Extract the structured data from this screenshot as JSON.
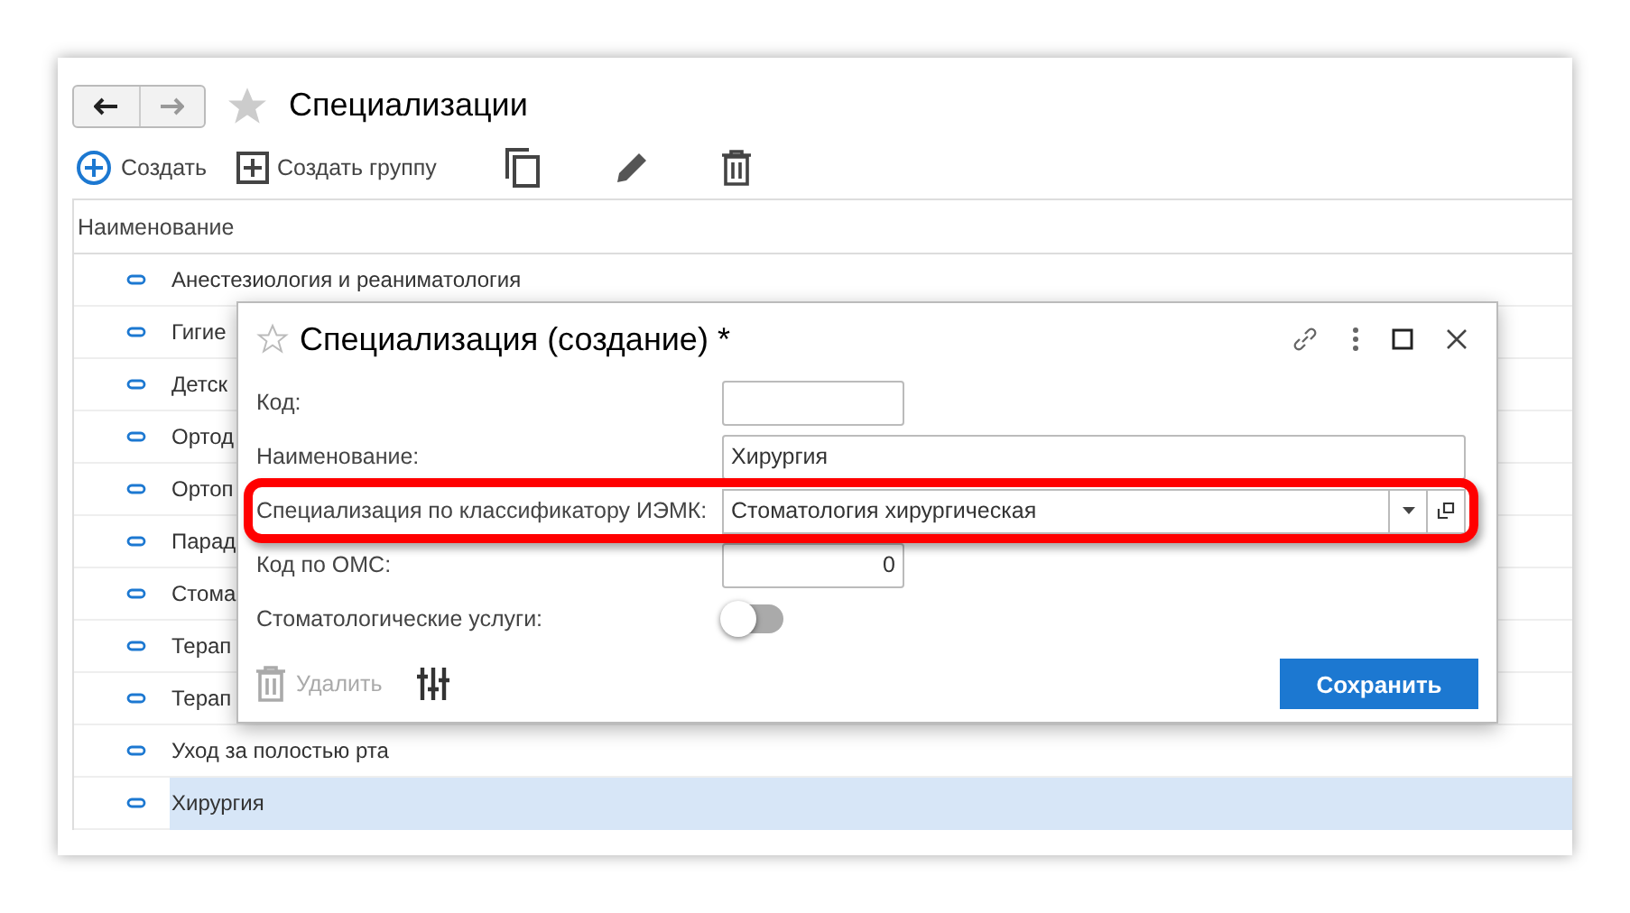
{
  "window": {
    "title": "Специализации",
    "favorite": false
  },
  "toolbar": [
    {
      "kind": "create",
      "label": "Создать"
    },
    {
      "kind": "group",
      "label": "Создать группу"
    },
    {
      "kind": "copy"
    },
    {
      "kind": "edit"
    },
    {
      "kind": "delete"
    }
  ],
  "table": {
    "columns": [
      "Наименование"
    ],
    "rows": [
      {
        "name": "Анестезиология и реаниматология",
        "selected": false
      },
      {
        "name": "Гигие",
        "selected": false
      },
      {
        "name": "Детск",
        "selected": false
      },
      {
        "name": "Ортод",
        "selected": false
      },
      {
        "name": "Ортоп",
        "selected": false
      },
      {
        "name": "Парад",
        "selected": false
      },
      {
        "name": "Стома",
        "selected": false
      },
      {
        "name": "Терап",
        "selected": false
      },
      {
        "name": "Терап",
        "selected": false
      },
      {
        "name": "Уход за полостью рта",
        "selected": false
      },
      {
        "name": "Хирургия",
        "selected": true
      }
    ]
  },
  "dialog": {
    "title": "Специализация (создание) *",
    "favorite": false,
    "fields": [
      {
        "kind": "text",
        "label": "Код:"
      },
      {
        "kind": "text",
        "label": "Наименование:",
        "value": "Хирургия"
      },
      {
        "kind": "select",
        "label": "Специализация по классификатору ИЭМК:",
        "value": "Стоматология хирургическая",
        "highlighted": true
      },
      {
        "kind": "number",
        "label": "Код по ОМС:",
        "value": "0"
      },
      {
        "kind": "toggle",
        "label": "Стоматологические услуги:",
        "on": false
      }
    ],
    "delete_button": {
      "label": "Удалить",
      "disabled": true
    },
    "save_button": {
      "label": "Сохранить"
    }
  }
}
